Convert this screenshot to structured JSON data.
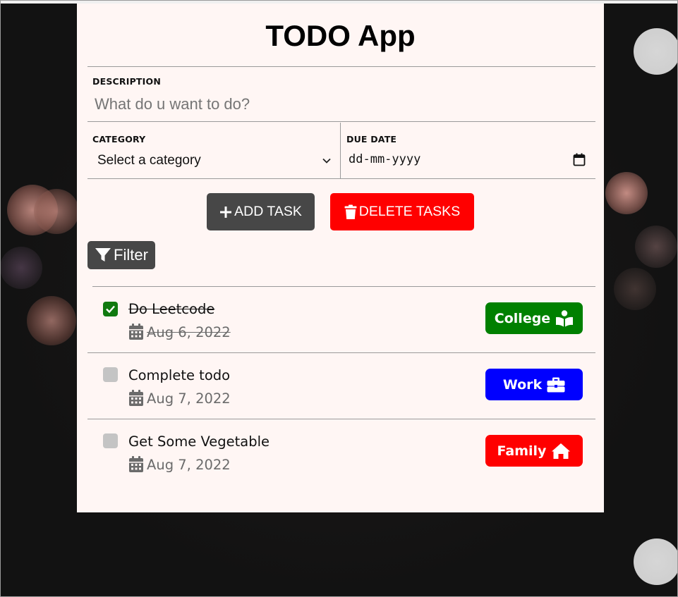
{
  "app": {
    "title": "TODO App"
  },
  "form": {
    "description_label": "DESCRIPTION",
    "description_placeholder": "What do u want to do?",
    "category_label": "CATEGORY",
    "category_selected": "Select a category",
    "due_date_label": "DUE DATE",
    "due_date_placeholder": "dd-mm-yyyy"
  },
  "actions": {
    "add_label": "ADD TASK",
    "delete_label": "DELETE TASKS",
    "filter_label": "Filter"
  },
  "tasks": [
    {
      "name": "Do Leetcode",
      "date": "Aug 6, 2022",
      "done": true,
      "category": "College",
      "category_icon": "book-reader-icon",
      "color": "#008000"
    },
    {
      "name": "Complete todo",
      "date": "Aug 7, 2022",
      "done": false,
      "category": "Work",
      "category_icon": "briefcase-icon",
      "color": "#0000ff"
    },
    {
      "name": "Get Some Vegetable",
      "date": "Aug 7, 2022",
      "done": false,
      "category": "Family",
      "category_icon": "home-icon",
      "color": "#ff0000"
    }
  ],
  "colors": {
    "card_bg": "#fff6f4",
    "button_dark": "#474747",
    "danger": "#ff0000",
    "check_done": "#107a10",
    "check_empty": "#c4c4c4"
  }
}
